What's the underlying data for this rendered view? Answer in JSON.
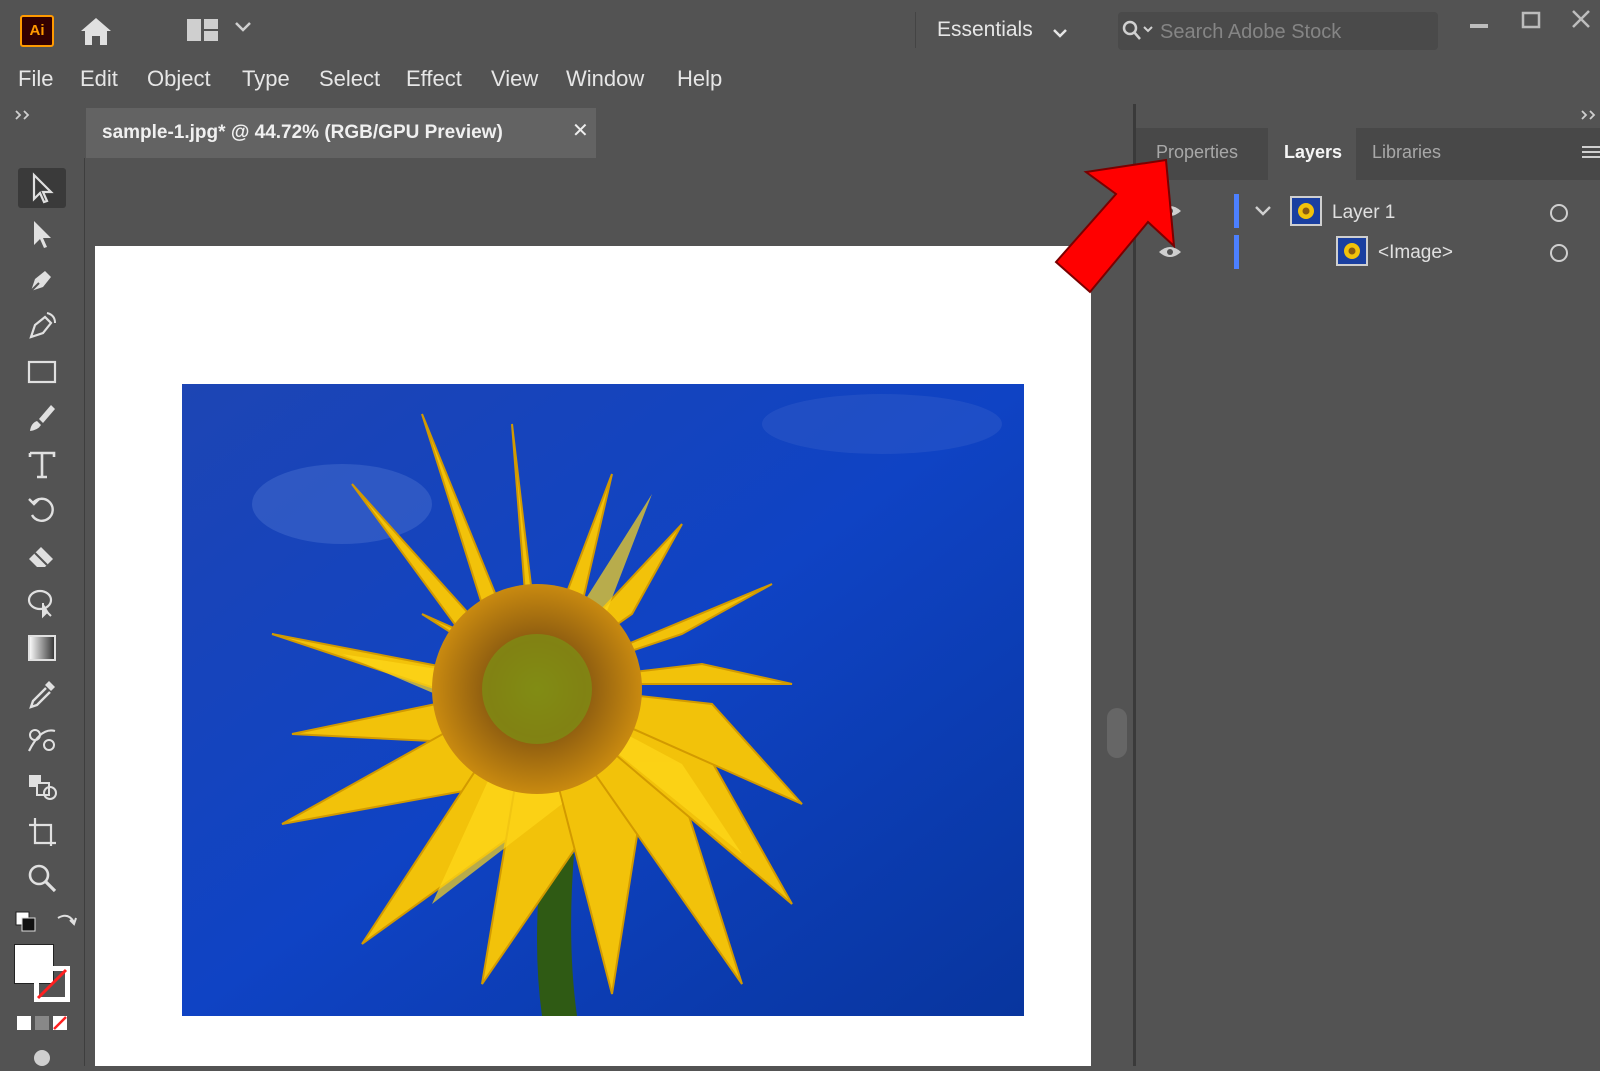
{
  "app": {
    "logo_text": "Ai"
  },
  "topbar": {
    "workspace_label": "Essentials",
    "search_placeholder": "Search Adobe Stock"
  },
  "menu": {
    "items": [
      "File",
      "Edit",
      "Object",
      "Type",
      "Select",
      "Effect",
      "View",
      "Window",
      "Help"
    ]
  },
  "document": {
    "tab_title": "sample-1.jpg* @ 44.72% (RGB/GPU Preview)",
    "close_glyph": "✕"
  },
  "panels": {
    "tabs": [
      "Properties",
      "Layers",
      "Libraries"
    ],
    "active_tab": "Layers"
  },
  "layers": [
    {
      "name": "Layer 1",
      "expanded": true
    },
    {
      "name": "<Image>",
      "expanded": false
    }
  ],
  "colors": {
    "accent": "#4c80ff",
    "annotation_arrow": "#ff0000",
    "ui_bg": "#535353"
  }
}
